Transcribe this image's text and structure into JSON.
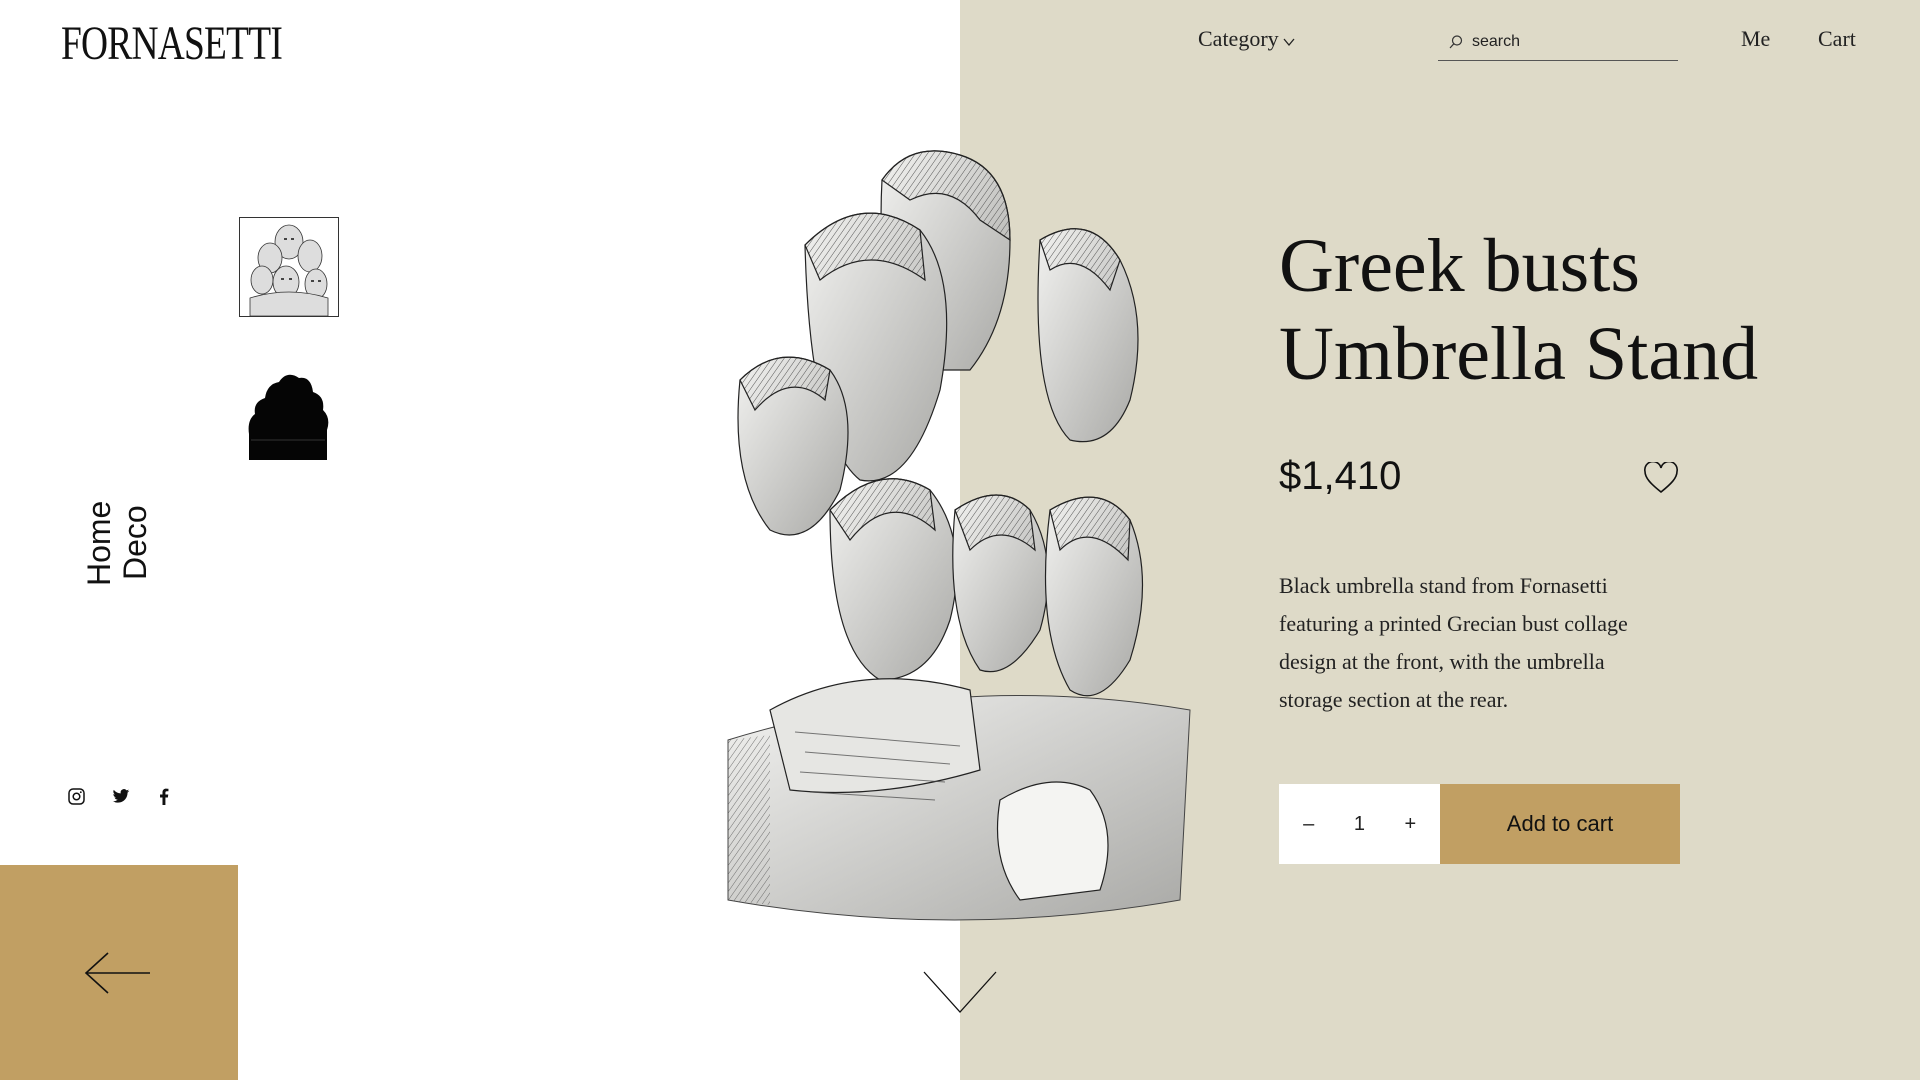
{
  "header": {
    "logo": "FORNASETTI",
    "category_label": "Category",
    "search_placeholder": "search",
    "me_label": "Me",
    "cart_label": "Cart"
  },
  "sidebar": {
    "category_line1": "Home",
    "category_line2": "Deco",
    "social": [
      "instagram-icon",
      "twitter-icon",
      "facebook-icon"
    ]
  },
  "product": {
    "title_line1": "Greek busts",
    "title_line2": "Umbrella Stand",
    "price": "$1,410",
    "description": "Black umbrella stand from Fornasetti featuring a printed Grecian bust collage design at the front, with the umbrella storage section at the rear.",
    "quantity": "1",
    "decrement": "–",
    "increment": "+",
    "add_to_cart": "Add to cart"
  },
  "colors": {
    "panel_bg": "#dedac8",
    "accent": "#c19f63",
    "text": "#111111"
  }
}
